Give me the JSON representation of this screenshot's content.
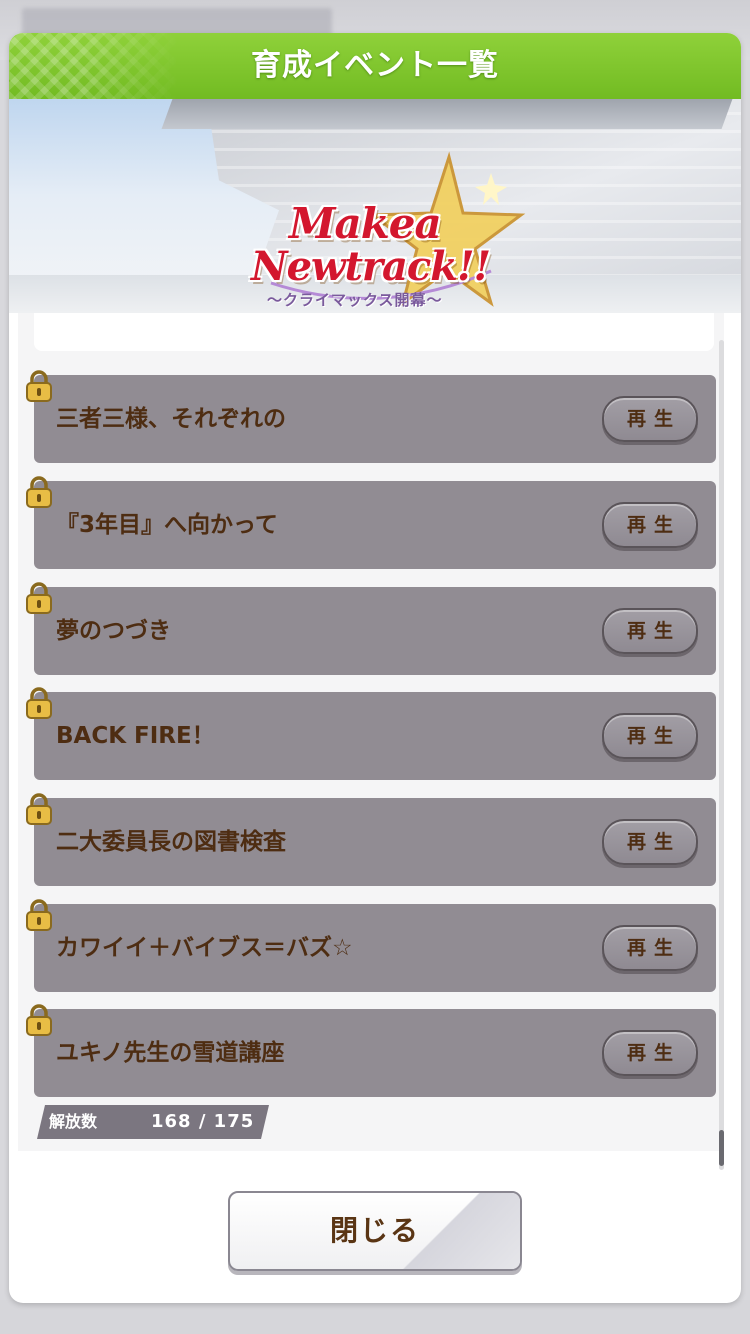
{
  "dialog": {
    "title": "育成イベント一覧"
  },
  "banner": {
    "logo_line1": "Makea",
    "logo_line2": "Newtrack!!",
    "logo_subtitle": "〜クライマックス開幕〜"
  },
  "partial_item": {
    "title": "",
    "locked": false
  },
  "events": [
    {
      "title": "三者三様、それぞれの",
      "button": "再生",
      "locked": true
    },
    {
      "title": "『3年目』へ向かって",
      "button": "再生",
      "locked": true
    },
    {
      "title": "夢のつづき",
      "button": "再生",
      "locked": true
    },
    {
      "title": "BACK FIRE！",
      "button": "再生",
      "locked": true
    },
    {
      "title": "二大委員長の図書検査",
      "button": "再生",
      "locked": true
    },
    {
      "title": "カワイイ＋バイブス＝バズ☆",
      "button": "再生",
      "locked": true
    },
    {
      "title": "ユキノ先生の雪道講座",
      "button": "再生",
      "locked": true
    }
  ],
  "release": {
    "label": "解放数",
    "count": "168 / 175"
  },
  "close_button": {
    "label": "閉じる"
  },
  "colors": {
    "header_green": "#7fc62d",
    "locked_card": "#918c93",
    "text_brown": "#4e2d12",
    "lock_gold": "#e0b23a"
  },
  "icons": {
    "lock": "lock-icon",
    "logo_star": "star-icon"
  }
}
